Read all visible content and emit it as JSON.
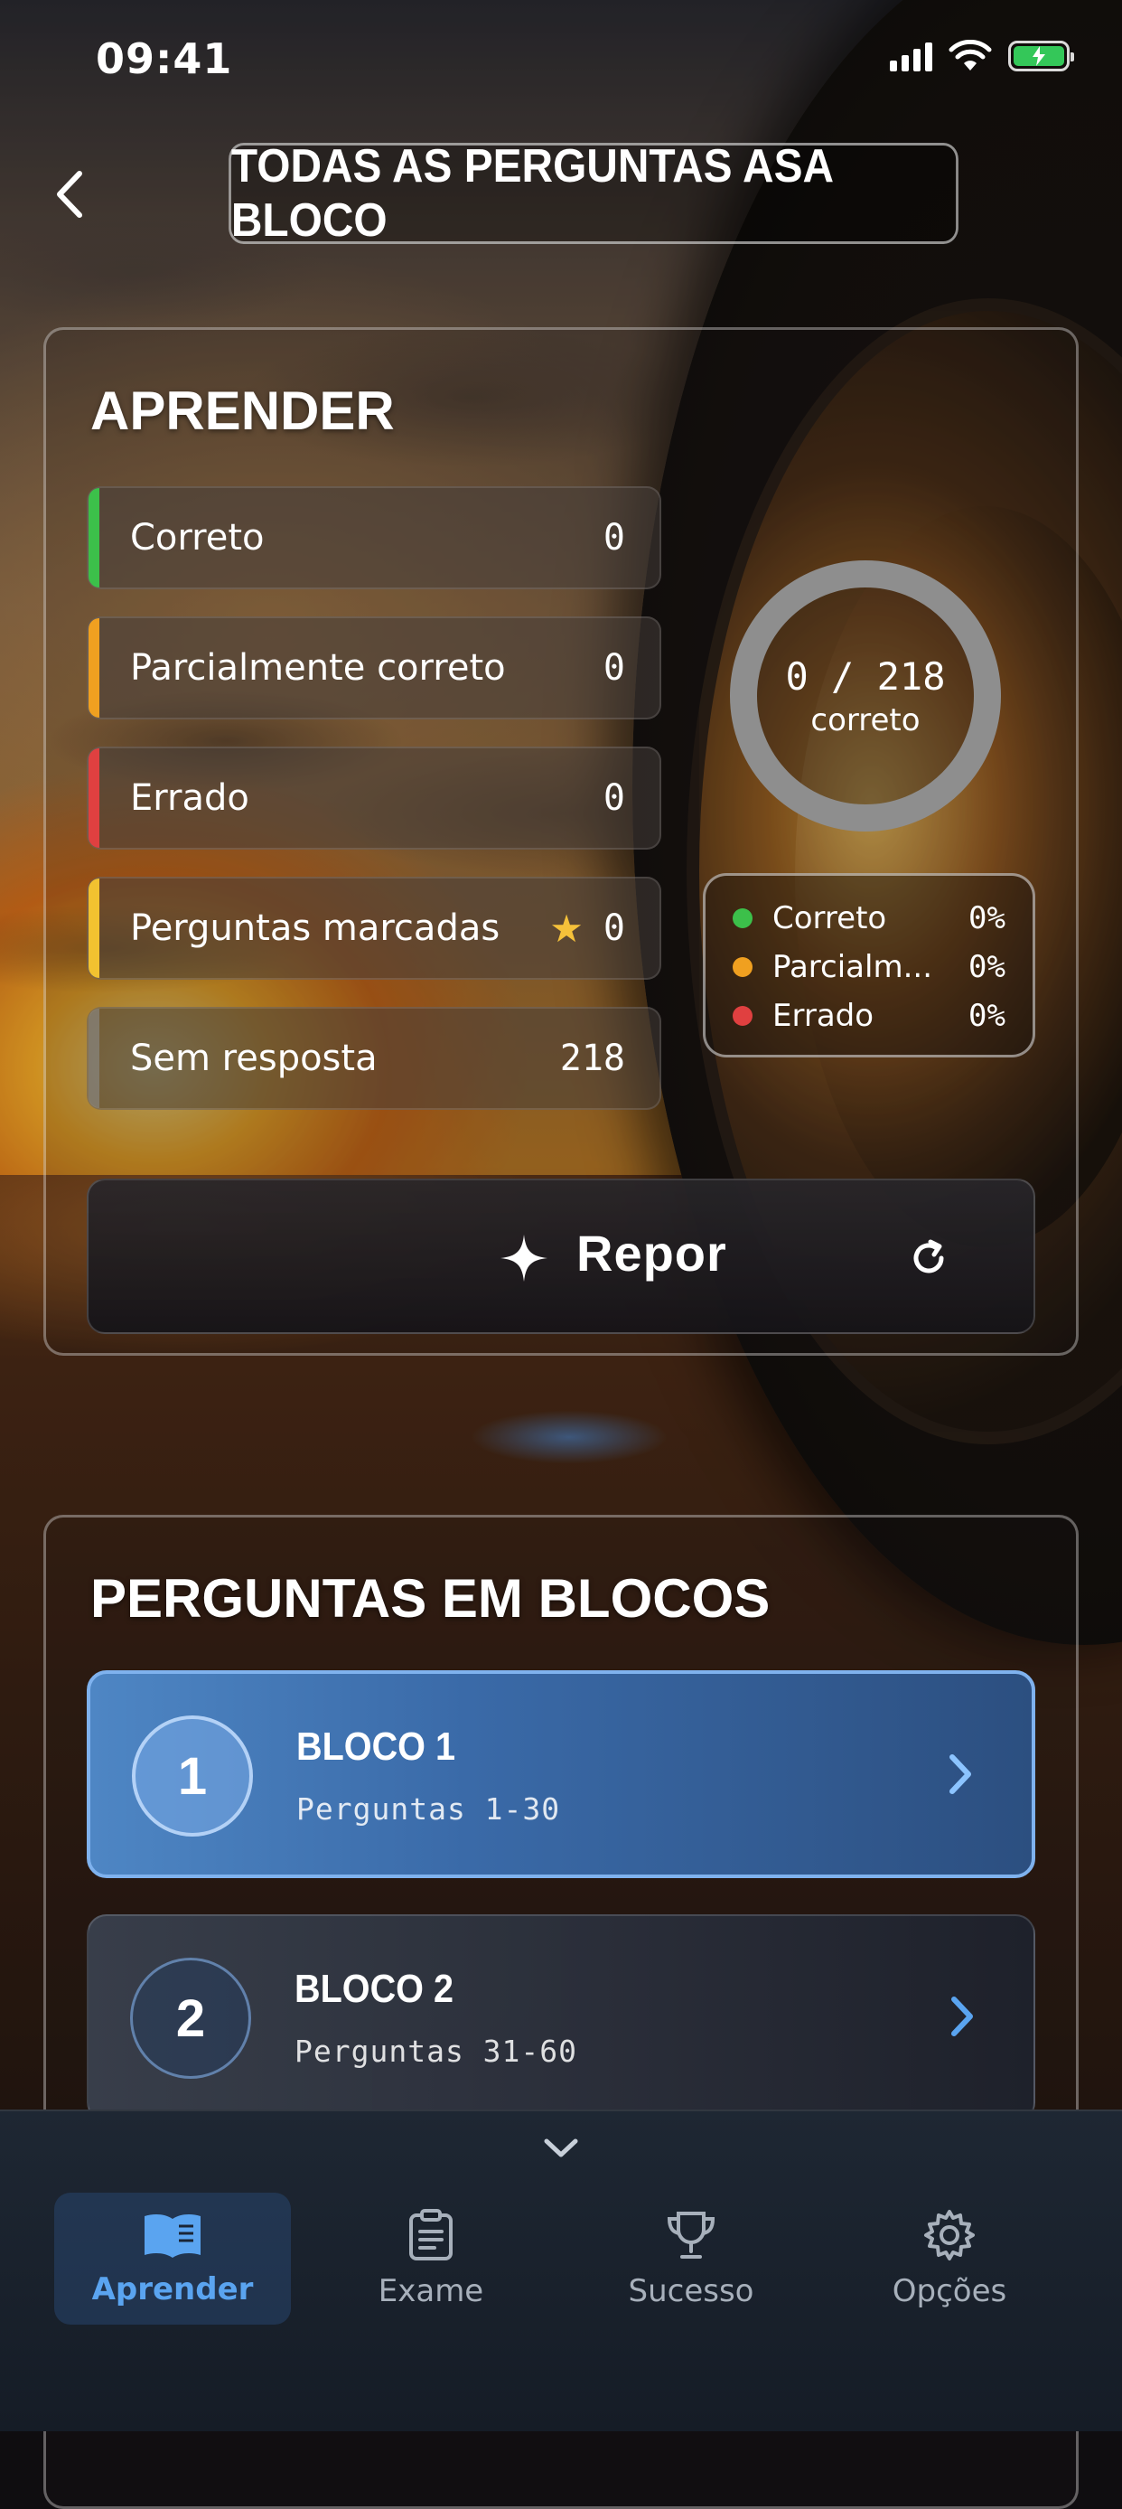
{
  "status_bar": {
    "time": "09:41"
  },
  "header": {
    "title": "TODAS AS PERGUNTAS ASA BLOCO"
  },
  "learn": {
    "title": "APRENDER",
    "stats": [
      {
        "label": "Correto",
        "value": "0",
        "color": "#3cc04a"
      },
      {
        "label": "Parcialmente correto",
        "value": "0",
        "color": "#f0a020"
      },
      {
        "label": "Errado",
        "value": "0",
        "color": "#e04040"
      },
      {
        "label": "Perguntas marcadas",
        "value": "0",
        "color": "#f2c230",
        "icon": "star-icon"
      },
      {
        "label": "Sem resposta",
        "value": "218",
        "color": "#8a8a8a"
      }
    ],
    "progress": {
      "count": "0 / 218",
      "label": "correto",
      "correct": 0,
      "total": 218
    },
    "legend": [
      {
        "name": "Correto",
        "pct": "0%",
        "color": "#3cc04a"
      },
      {
        "name": "Parcialm...",
        "pct": "0%",
        "color": "#f0a020"
      },
      {
        "name": "Errado",
        "pct": "0%",
        "color": "#e04040"
      }
    ],
    "reset_label": "Repor"
  },
  "blocks": {
    "title": "PERGUNTAS EM BLOCOS",
    "items": [
      {
        "number": "1",
        "name": "BLOCO 1",
        "range": "Perguntas 1-30"
      },
      {
        "number": "2",
        "name": "BLOCO 2",
        "range": "Perguntas 31-60"
      }
    ]
  },
  "tabs": [
    {
      "label": "Aprender",
      "icon": "book-icon",
      "active": true
    },
    {
      "label": "Exame",
      "icon": "clipboard-icon",
      "active": false
    },
    {
      "label": "Sucesso",
      "icon": "trophy-icon",
      "active": false
    },
    {
      "label": "Opções",
      "icon": "gear-icon",
      "active": false
    }
  ],
  "colors": {
    "accent": "#5aa4f0",
    "active_block": "#3a6aa8"
  }
}
